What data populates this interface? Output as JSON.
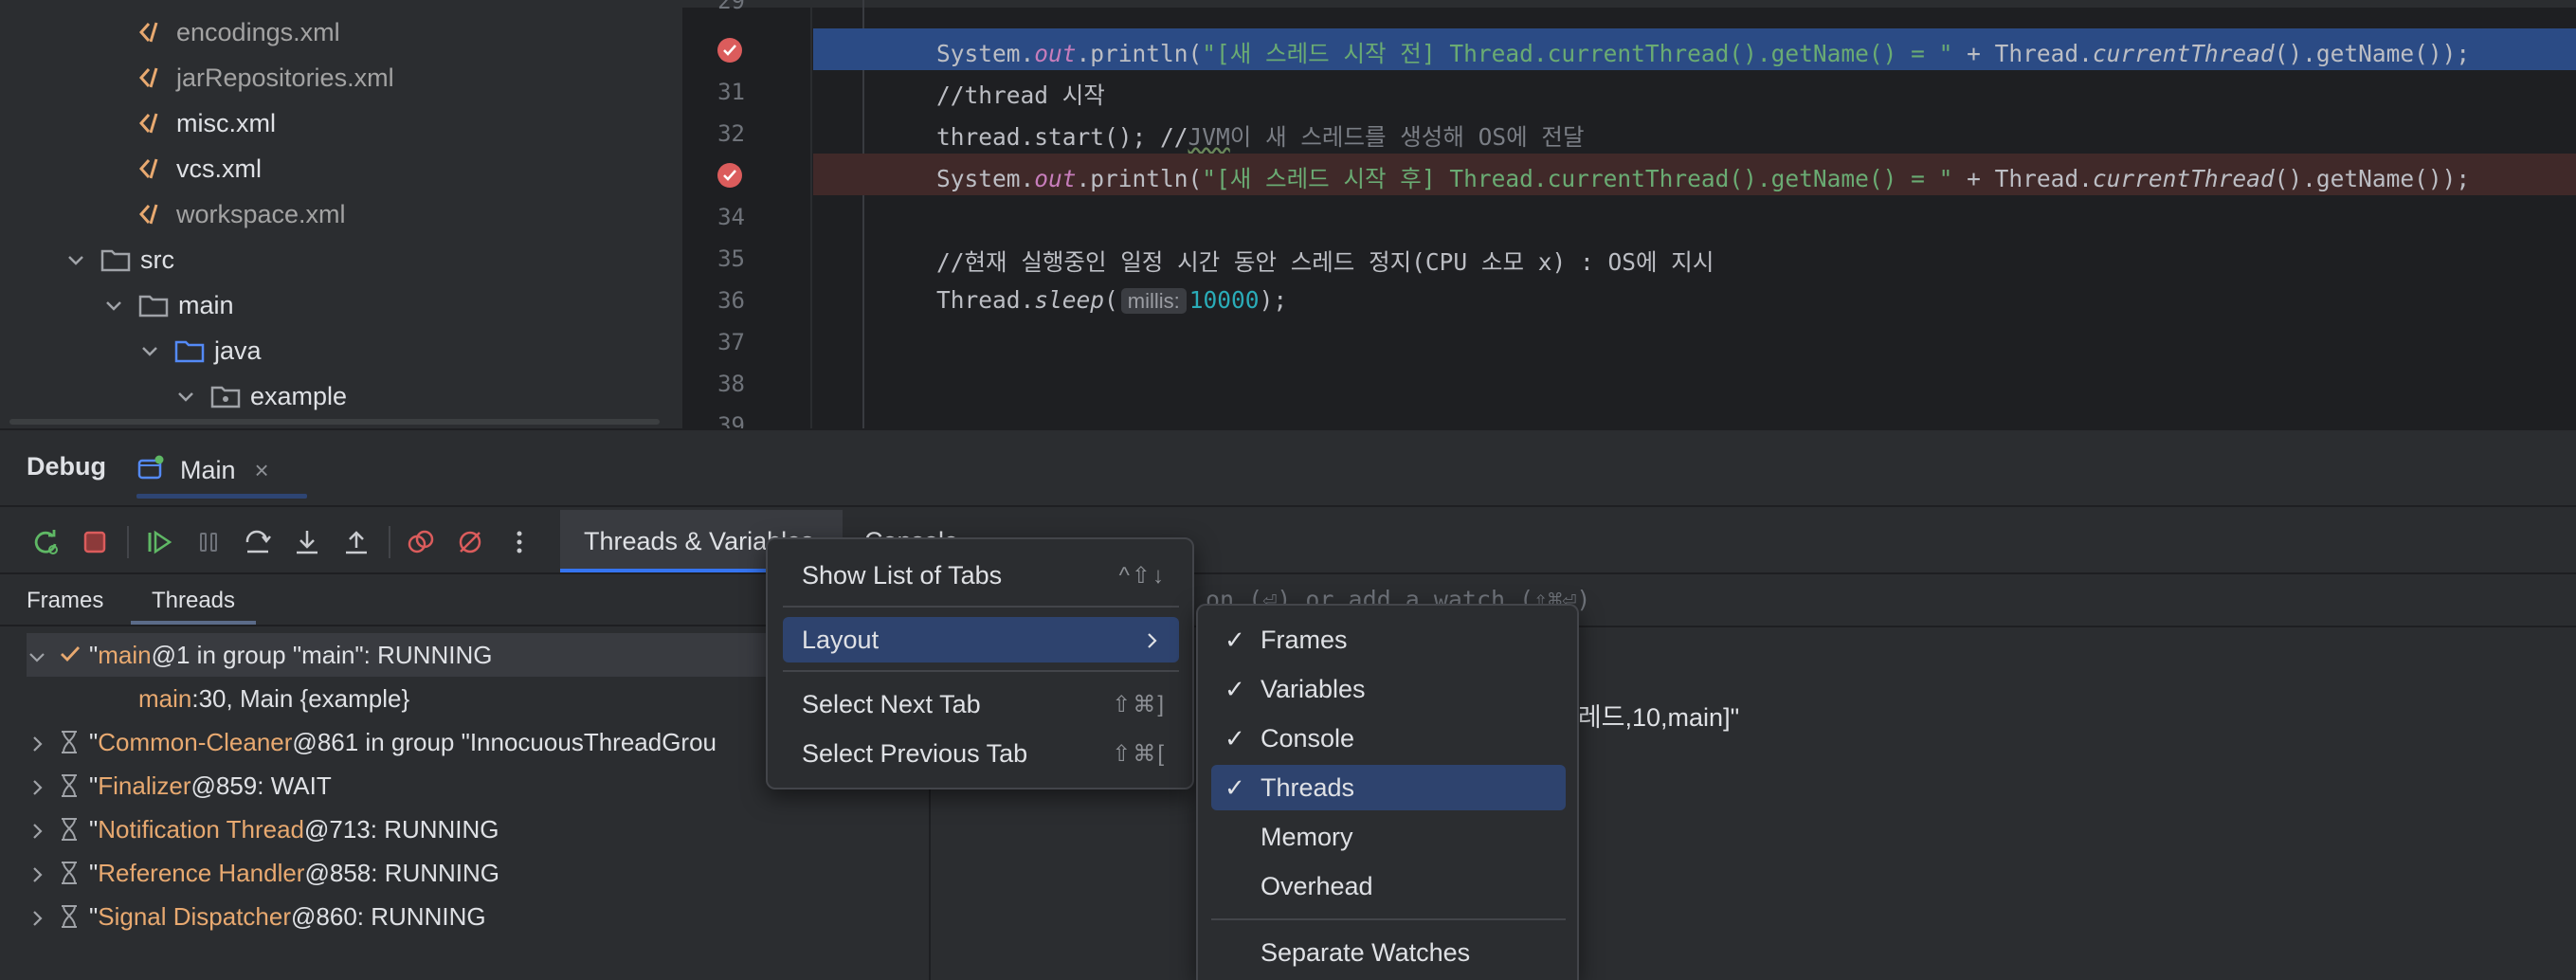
{
  "project_tree": {
    "items": [
      {
        "label": "encodings.xml",
        "dim": true
      },
      {
        "label": "jarRepositories.xml",
        "dim": true
      },
      {
        "label": "misc.xml",
        "dim": false
      },
      {
        "label": "vcs.xml",
        "dim": false
      },
      {
        "label": "workspace.xml",
        "dim": true
      },
      {
        "label": "src"
      },
      {
        "label": "main"
      },
      {
        "label": "java"
      },
      {
        "label": "example"
      }
    ]
  },
  "editor": {
    "lines": [
      {
        "num": "29"
      },
      {
        "num": "",
        "code": {
          "p1": "System.",
          "p2": "out",
          "p3": ".println(",
          "p4": "\"[새 스레드 시작 전] Thread.currentThread().getName() = \"",
          "p5": " + Thread.",
          "p6": "currentThread",
          "p7": "().getName());"
        }
      },
      {
        "num": "31",
        "text": "//thread 시작"
      },
      {
        "num": "32",
        "p1": "thread.start(); //",
        "p2": "JVM",
        "p3": "이 새 스레드를 생성해 OS에 전달"
      },
      {
        "num": "",
        "code": {
          "p1": "System.",
          "p2": "out",
          "p3": ".println(",
          "p4": "\"[새 스레드 시작 후] Thread.currentThread().getName() = \"",
          "p5": " + Thread.",
          "p6": "currentThread",
          "p7": "().getName());"
        }
      },
      {
        "num": "34"
      },
      {
        "num": "35",
        "text": "//현재 실행중인 일정 시간 동안 스레드 정지(CPU 소모 x) : OS에 지시"
      },
      {
        "num": "36",
        "p1": "Thread.",
        "p2": "sleep",
        "p3": "(",
        "hint": "millis:",
        "p4": "10000",
        "p5": ");"
      },
      {
        "num": "37"
      },
      {
        "num": "38"
      },
      {
        "num": "39"
      }
    ]
  },
  "debug": {
    "title": "Debug",
    "main_tab": "Main",
    "close": "×",
    "tabs": {
      "threads_vars": "Threads & Variables",
      "console": "Console"
    },
    "frames_tab": "Frames",
    "threads_tab": "Threads",
    "vars_placeholder": "on (⏎) or add a watch (⇧⌘⏎)",
    "vars_value": "스레드,10,main]\""
  },
  "threads": [
    {
      "name": "main",
      "rest": "@1 in group \"main\": RUNNING"
    },
    {
      "frame_name": "main",
      "frame_rest": ":30, Main {example}"
    },
    {
      "name": "Common-Cleaner",
      "rest": "@861 in group \"InnocuousThreadGrou"
    },
    {
      "name": "Finalizer",
      "rest": "@859: WAIT"
    },
    {
      "name": "Notification Thread",
      "rest": "@713: RUNNING"
    },
    {
      "name": "Reference Handler",
      "rest": "@858: RUNNING"
    },
    {
      "name": "Signal Dispatcher",
      "rest": "@860: RUNNING"
    }
  ],
  "menu": {
    "items": [
      {
        "label": "Show List of Tabs",
        "shortcut": "^⇧↓"
      },
      {
        "label": "Layout"
      },
      {
        "label": "Select Next Tab",
        "shortcut": "⇧⌘]"
      },
      {
        "label": "Select Previous Tab",
        "shortcut": "⇧⌘["
      }
    ]
  },
  "submenu": {
    "items": [
      {
        "label": "Frames",
        "check": "✓"
      },
      {
        "label": "Variables",
        "check": "✓"
      },
      {
        "label": "Console",
        "check": "✓"
      },
      {
        "label": "Threads",
        "check": "✓"
      },
      {
        "label": "Memory",
        "check": ""
      },
      {
        "label": "Overhead",
        "check": ""
      },
      {
        "label": "Separate Watches",
        "check": ""
      }
    ]
  },
  "colors": {
    "accent": "#3574f0",
    "selection": "#2e436e",
    "breakpoint": "#db5c5c",
    "thread_name": "#e8a970",
    "string": "#6aab73"
  }
}
